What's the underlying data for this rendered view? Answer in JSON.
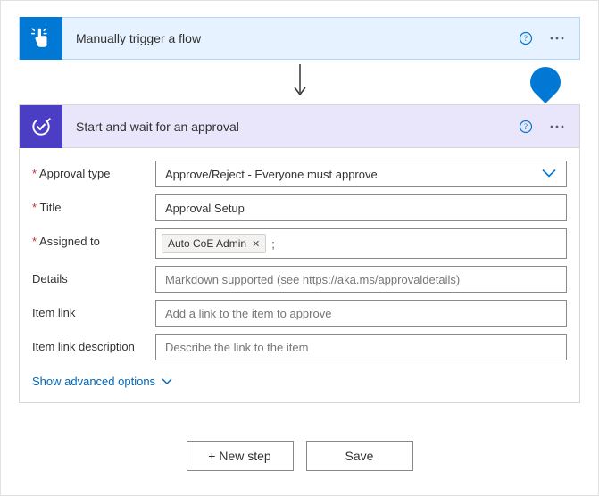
{
  "trigger": {
    "title": "Manually trigger a flow"
  },
  "action": {
    "title": "Start and wait for an approval",
    "fields": {
      "approval_type": {
        "label": "Approval type",
        "value": "Approve/Reject - Everyone must approve"
      },
      "title": {
        "label": "Title",
        "value": "Approval Setup"
      },
      "assigned_to": {
        "label": "Assigned to",
        "token": "Auto CoE Admin"
      },
      "details": {
        "label": "Details",
        "placeholder": "Markdown supported (see https://aka.ms/approvaldetails)"
      },
      "item_link": {
        "label": "Item link",
        "placeholder": "Add a link to the item to approve"
      },
      "item_link_desc": {
        "label": "Item link description",
        "placeholder": "Describe the link to the item"
      }
    },
    "advanced_label": "Show advanced options"
  },
  "footer": {
    "new_step": "+ New step",
    "save": "Save"
  }
}
